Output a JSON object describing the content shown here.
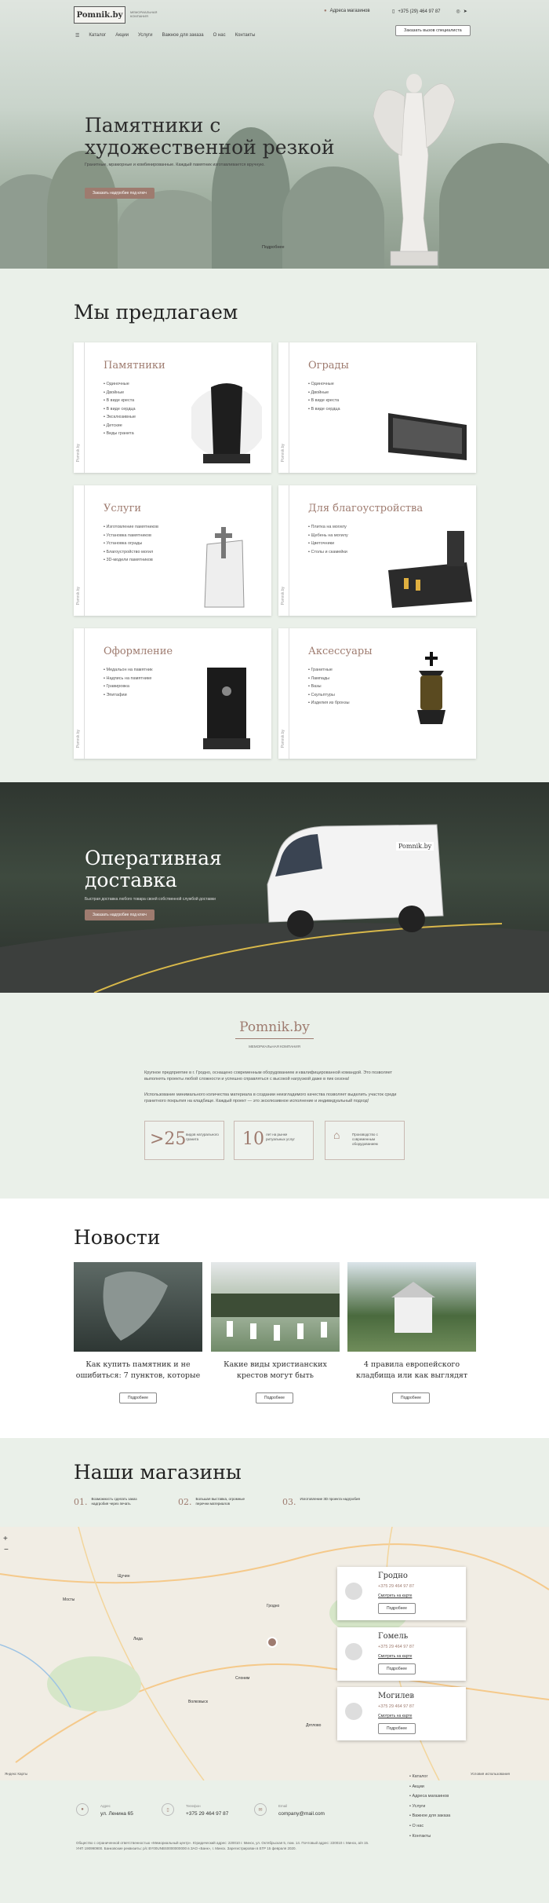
{
  "header": {
    "logo": "Pomnik.by",
    "logo_sub": "МЕМОРИАЛЬНАЯ КОМПАНИЯ",
    "address": "Адреса магазинов",
    "phone": "+375 (29) 464 97 87",
    "order_btn": "Заказать вызов специалиста",
    "nav": [
      "Каталог",
      "Акции",
      "Услуги",
      "Важное для заказа",
      "О нас",
      "Контакты"
    ]
  },
  "hero": {
    "title_1": "Памятники с",
    "title_2": "художественной резкой",
    "subtitle": "Гранитные, мраморные и комбинированные. Каждый памятник изготавливается вручную.",
    "cta": "Заказать надгробие под ключ",
    "more": "Подробнее"
  },
  "offer": {
    "title": "Мы предлагаем",
    "brand": "Pomnik.by",
    "cards": [
      {
        "title": "Памятники",
        "items": [
          "Одиночные",
          "Двойные",
          "В виде креста",
          "В виде сердца",
          "Эксклюзивные",
          "Детские",
          "Виды гранита"
        ]
      },
      {
        "title": "Ограды",
        "items": [
          "Одиночные",
          "Двойные",
          "В виде креста",
          "В виде сердца"
        ]
      },
      {
        "title": "Услуги",
        "items": [
          "Изготовление памятников",
          "Установка памятников",
          "Установка ограды",
          "Благоустройство могил",
          "3D-модели памятников"
        ]
      },
      {
        "title": "Для благоустройства",
        "items": [
          "Плитка на могилу",
          "Щебень на могилу",
          "Цветочники",
          "Столы и скамейки"
        ]
      },
      {
        "title": "Оформление",
        "items": [
          "Медальон на памятник",
          "Надпись на памятнике",
          "Гравировка",
          "Эпитафии"
        ]
      },
      {
        "title": "Аксессуары",
        "items": [
          "Гранитные",
          "Лампады",
          "Вазы",
          "Скульптуры",
          "Изделия из бронзы"
        ]
      }
    ]
  },
  "delivery": {
    "title_1": "Оперативная",
    "title_2": "доставка",
    "subtitle": "Быстрая доставка любого товара своей собственной службой доставки",
    "cta": "Заказать надгробие под ключ",
    "van_logo": "Pomnik.by"
  },
  "about": {
    "logo": "Pomnik.by",
    "sub": "МЕМОРИАЛЬНАЯ КОМПАНИЯ",
    "p1": "Крупное предприятие в г. Гродно, оснащено современным оборудованием и квалифицированной командой. Это позволяет выполнять проекты любой сложности и успешно справляться с высокой нагрузкой даже в пик сезона!",
    "p2": "Использование минимального количества материала в создании неизгладимого качества позволяет выделить участок среди гранитного покрытия на кладбище. Каждый проект — это эксклюзивное исполнение и индивидуальный подход!",
    "stats": [
      {
        "num": ">25",
        "text": "видов натурального гранита"
      },
      {
        "num": "10",
        "text": "лет на рынке ритуальных услуг"
      },
      {
        "num": "",
        "text": "Производство с современным оборудованием"
      }
    ]
  },
  "news": {
    "title": "Новости",
    "more": "Подробнее",
    "items": [
      {
        "title": "Как купить памятник и не ошибиться: 7 пунктов, которые"
      },
      {
        "title": "Какие виды христианских крестов могут быть"
      },
      {
        "title": "4 правила европейского кладбища или как выглядят"
      }
    ]
  },
  "stores": {
    "title": "Наши магазины",
    "steps": [
      {
        "num": "01.",
        "text": "Возможность сделать заказ надгробия через печать"
      },
      {
        "num": "02.",
        "text": "Большая выставка, огромные перечни материалов"
      },
      {
        "num": "03.",
        "text": "Изготовление 3D проекта надгробия"
      }
    ],
    "shops": [
      {
        "city": "Гродно",
        "phone": "+375 29 464 97 87",
        "link": "Смотреть на карте",
        "btn": "Подробнее"
      },
      {
        "city": "Гомель",
        "phone": "+375 29 464 97 87",
        "link": "Смотреть на карте",
        "btn": "Подробнее"
      },
      {
        "city": "Могилев",
        "phone": "+375 29 464 97 87",
        "link": "Смотреть на карте",
        "btn": "Подробнее"
      }
    ],
    "map_cities": [
      "Гродно",
      "Лида",
      "Слоним",
      "Волковыск",
      "Мосты",
      "Щучин",
      "Дятлово"
    ],
    "map_footer": "Яндекс Карты",
    "map_terms": "Условия использования"
  },
  "footer": {
    "addr_label": "Адрес",
    "addr": "ул. Ленина 65",
    "phone_label": "Телефон",
    "phone": "+375 29 464 97 87",
    "email_label": "Email",
    "email": "company@mail.com",
    "legal": "Общество с ограниченной ответственностью «Мемориальный центр». Юридический адрес: 220010 г. Минск, ул. Октябрьская 5, пом. 14. Почтовый адрес: 220010 г. Минск, а/я 15. УНП 190990900. Банковские реквизиты: р/с BY00UNBS0000000000 в ЗАО «Банк», г. Минск. Зарегистрирован в ЕГР 15 февраля 2020.",
    "nav": [
      "Каталог",
      "Акции",
      "Адреса магазинов",
      "Услуги",
      "Важное для заказа",
      "О нас",
      "Контакты"
    ]
  }
}
